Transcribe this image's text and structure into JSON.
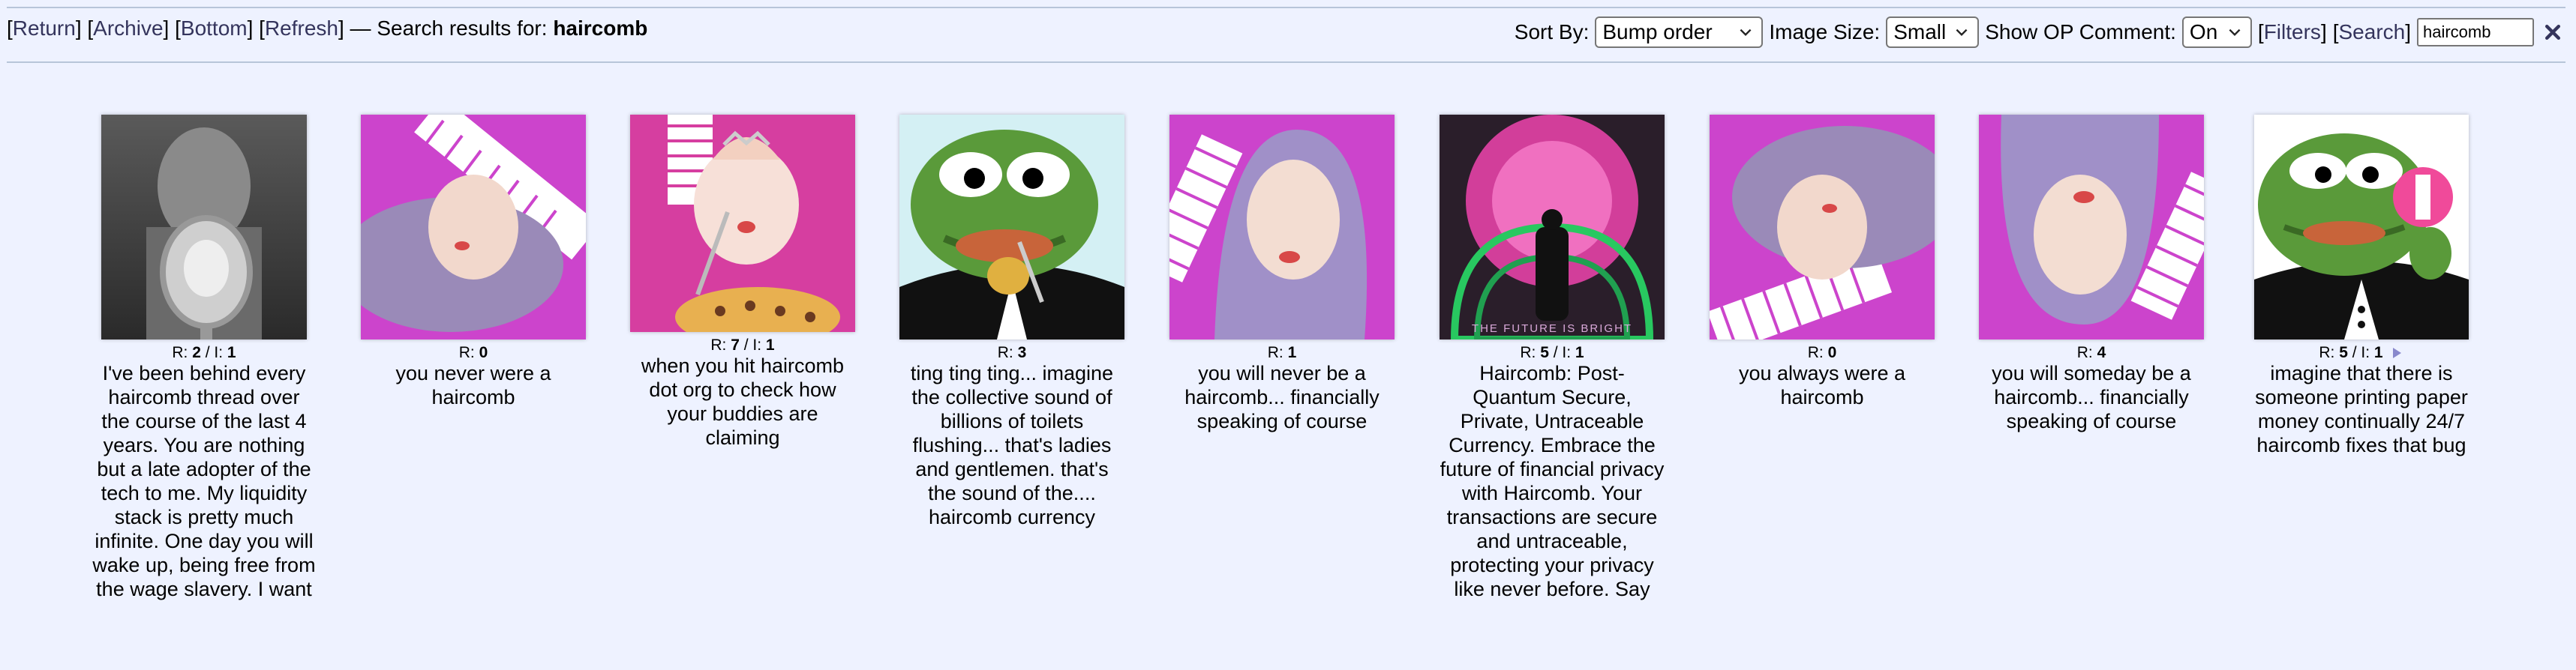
{
  "nav": {
    "return_label": "Return",
    "archive_label": "Archive",
    "bottom_label": "Bottom",
    "refresh_label": "Refresh",
    "search_prefix": " — Search results for: ",
    "query": "haircomb"
  },
  "controls": {
    "sort_label": "Sort By:",
    "sort_value": "Bump order",
    "size_label": "Image Size:",
    "size_value": "Small",
    "op_label": "Show OP Comment:",
    "op_value": "On",
    "filters_label": "Filters",
    "search_label": "Search",
    "search_value": "haircomb"
  },
  "threads": [
    {
      "r": "2",
      "i": "1",
      "teaser": "I've been behind every haircomb thread over the course of the last 4 years. You are nothing but a late adopter of the tech to me. My liquidity stack is pretty much infinite. One day you will wake up, being free from the wage slavery. I want"
    },
    {
      "r": "0",
      "i": "",
      "teaser": "you never were a haircomb"
    },
    {
      "r": "7",
      "i": "1",
      "teaser": "when you hit haircomb dot org to check how your buddies are claiming"
    },
    {
      "r": "3",
      "i": "",
      "teaser": "ting ting ting... imagine the collective sound of billions of toilets flushing... that's ladies and gentlemen. that's the sound of the.... haircomb currency"
    },
    {
      "r": "1",
      "i": "",
      "teaser": "you will never be a haircomb... financially speaking of course"
    },
    {
      "r": "5",
      "i": "1",
      "teaser": "Haircomb: Post-Quantum Secure, Private, Untraceable Currency. Embrace the future of financial privacy with Haircomb. Your transactions are secure and untraceable, protecting your privacy like never before. Say",
      "image_text": "THE FUTURE IS BRIGHT"
    },
    {
      "r": "0",
      "i": "",
      "teaser": "you always were a haircomb"
    },
    {
      "r": "4",
      "i": "",
      "teaser": "you will someday be a haircomb... financially speaking of course"
    },
    {
      "r": "5",
      "i": "1",
      "teaser": "imagine that there is someone printing paper money continually 24/7 haircomb fixes that bug"
    }
  ],
  "labels": {
    "r": "R: ",
    "i": " / I: "
  },
  "colors": {
    "background": "#eef2ff",
    "link": "#34345c",
    "divider": "#b7c5d9",
    "magenta": "#cc44cc",
    "pepe_green": "#5a9a3a"
  }
}
